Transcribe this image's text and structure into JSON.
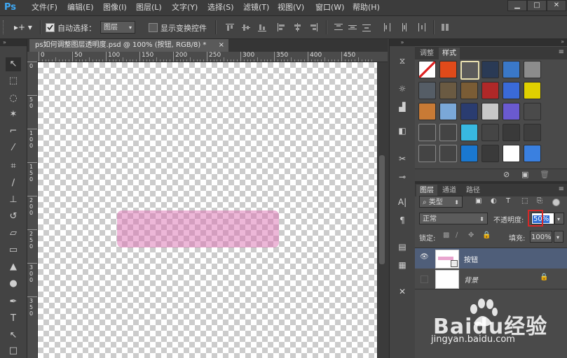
{
  "app": {
    "logo": "Ps"
  },
  "menu": {
    "items": [
      "文件(F)",
      "编辑(E)",
      "图像(I)",
      "图层(L)",
      "文字(Y)",
      "选择(S)",
      "滤镜(T)",
      "视图(V)",
      "窗口(W)",
      "帮助(H)"
    ],
    "window_buttons": [
      "▁",
      "□",
      "✕"
    ]
  },
  "options": {
    "auto_select_label": "自动选择：",
    "auto_select_value": "图层",
    "show_transform_label": "显示变换控件"
  },
  "document": {
    "tab_title": "ps如何调整图层透明度.psd @ 100% (按钮, RGB/8) *",
    "tab_close": "×",
    "ruler_h_ticks": [
      "0",
      "50",
      "100",
      "150",
      "200",
      "250",
      "300",
      "350",
      "400",
      "450"
    ],
    "ruler_v_ticks": [
      "0",
      "5\n0",
      "1\n0\n0",
      "1\n5\n0",
      "2\n0\n0",
      "2\n5\n0",
      "3\n0\n0",
      "3\n5\n0"
    ],
    "shape_color": "#db70b2",
    "shape_opacity": 0.5
  },
  "styles_panel": {
    "tabs": [
      "调整",
      "样式"
    ],
    "active_tab": "样式"
  },
  "layers_panel": {
    "tabs": [
      "图层",
      "通道",
      "路径"
    ],
    "active_tab": "图层",
    "filter_label": "类型",
    "blend_mode": "正常",
    "opacity_label": "不透明度:",
    "opacity_value": "50%",
    "lock_label": "锁定:",
    "fill_label": "填充:",
    "fill_value": "100%",
    "layers": [
      {
        "name": "按钮",
        "visible": true,
        "selected": true
      },
      {
        "name": "背景",
        "visible": false,
        "selected": false,
        "locked": true
      }
    ]
  },
  "watermark": {
    "brand": "Baidu经验",
    "url": "jingyan.baidu.com"
  }
}
